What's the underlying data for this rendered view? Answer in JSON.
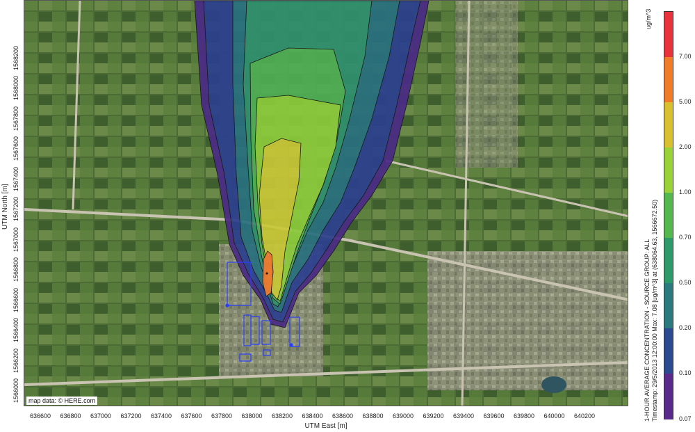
{
  "map": {
    "attribution": "map data: © HERE.com",
    "x_axis_title": "UTM East [m]",
    "y_axis_title": "UTM North [m]",
    "x_ticks": [
      "636600",
      "636800",
      "637000",
      "637200",
      "637400",
      "637600",
      "637800",
      "638000",
      "638200",
      "638400",
      "638600",
      "638800",
      "639000",
      "639200",
      "639400",
      "639600",
      "639800",
      "640000",
      "640200"
    ],
    "y_ticks": [
      "1566000",
      "1566200",
      "1566400",
      "1566600",
      "1566800",
      "1567000",
      "1567200",
      "1567400",
      "1567600",
      "1567800",
      "1568000",
      "1568200"
    ]
  },
  "legend": {
    "unit": "ug/m^3",
    "levels": [
      "7.00",
      "5.00",
      "2.00",
      "1.00",
      "0.70",
      "0.50",
      "0.20",
      "0.10",
      "0.07"
    ],
    "colors": [
      "#e8323c",
      "#f07c2a",
      "#d9c030",
      "#9bd23a",
      "#55b84e",
      "#2e9a6a",
      "#2a7a80",
      "#2c4a90",
      "#5a2a8a"
    ]
  },
  "caption": {
    "line1": "1-HOUR AVERAGE CONCENTRATION - SOURCE GROUP: ALL",
    "line2": "Timestamp: 29/5/2013 12:00:00  Max: 7.08 [ug/m^3]  at  (638064.63, 1566672.50)"
  },
  "plume_colors": {
    "level1": "#4b2a86",
    "level2": "#2c3f8f",
    "level3": "#28707f",
    "level4": "#2f8f6f",
    "level5": "#4fae55",
    "level6": "#8ccb3c",
    "level7": "#c9c737",
    "level8": "#d9a73a",
    "level9": "#ee7a2c"
  }
}
